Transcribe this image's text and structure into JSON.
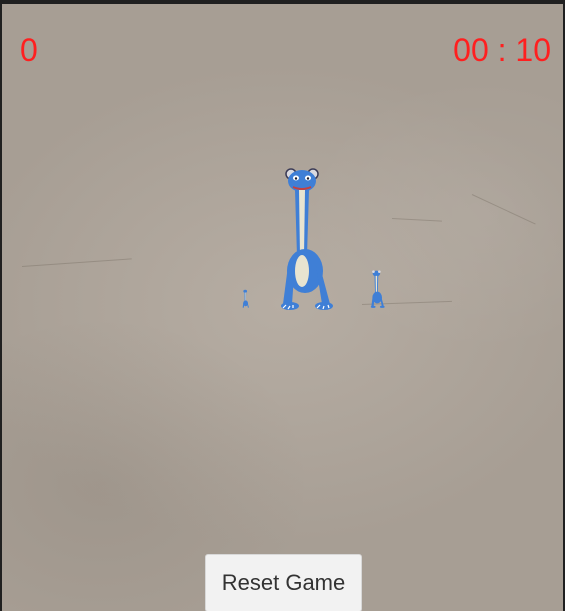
{
  "hud": {
    "score": "0",
    "timer": "00 : 10"
  },
  "targets": [
    {
      "icon": "dinosaur-icon",
      "size": "large",
      "color": "#3f7fd6"
    },
    {
      "icon": "dinosaur-icon",
      "size": "small",
      "color": "#3f7fd6"
    },
    {
      "icon": "dinosaur-icon",
      "size": "tiny",
      "color": "#3f7fd6"
    }
  ],
  "controls": {
    "reset_label": "Reset Game"
  },
  "colors": {
    "hud_text": "#ff1f1f",
    "dino_body": "#3f7fd6",
    "dino_belly": "#e8e4d0",
    "wall": "#aea59b"
  }
}
